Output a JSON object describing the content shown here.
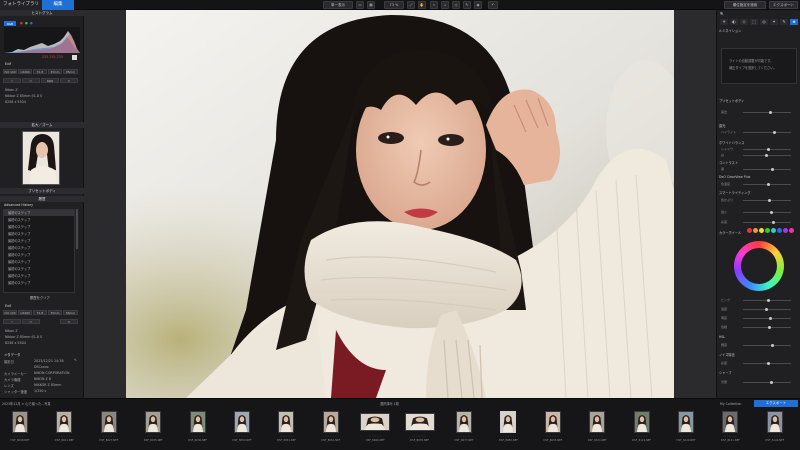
{
  "topbar": {
    "tab_photolibrary": "フォトライブラリ",
    "tab_edit": "編集",
    "view_select": "単一表示",
    "zoom": "73 %",
    "right_button_1": "順位指定を適用",
    "right_button_2": "エクスポート"
  },
  "left_panel": {
    "histogram_title": "ヒストグラム",
    "histogram_mode": "RGB",
    "histogram_values": "255  255  255",
    "exif_title": "Exif",
    "exif_row1": [
      "ISO 100",
      "1/4000",
      "f/1.8",
      "35mm",
      "85mm"
    ],
    "exif_row2": [
      "",
      "",
      "RAW",
      ""
    ],
    "exif_camera": "Nikon Z",
    "exif_lens": "Nikkor Z 85mm f/1.8 S",
    "exif_size": "8256 x 5504",
    "navigator_title": "拡大／ズーム",
    "presets_title": "プリセットボディ",
    "history_title": "履歴",
    "history_subtitle": "Advanced History",
    "history_items": [
      "最初のステップ",
      "最初のステップ",
      "最初のステップ",
      "最初のステップ",
      "最初のステップ",
      "最初のステップ",
      "最初のステップ",
      "最初のステップ",
      "最初のステップ",
      "最初のステップ",
      "最初のステップ"
    ],
    "history_clear": "履歴をクリア",
    "exif2_title": "Exif",
    "exif2_row1": [
      "ISO 100",
      "1/4000",
      "f/1.8",
      "35mm",
      "85mm"
    ],
    "exif2_camera": "Nikon Z",
    "exif2_lens": "Nikkor Z 85mm f/1.8 S",
    "exif2_size": "8256 x 5504",
    "meta_title": "メタデータ",
    "meta_rows": [
      {
        "label": "撮影日",
        "value": "2023/12/21 14:38"
      },
      {
        "label": "",
        "value": "DSCxxxx"
      },
      {
        "label": "カメラメーカー",
        "value": "NIKON CORPORATION"
      },
      {
        "label": "カメラ機種",
        "value": "NIKON Z 8"
      },
      {
        "label": "レンズ",
        "value": "NIKKOR Z 85mm"
      },
      {
        "label": "シャッター速度",
        "value": "1/250 s"
      }
    ]
  },
  "right_panel": {
    "top_title": "ルミネイション",
    "top_note_1": "ライトの自動調整が可能です。",
    "top_note_2": "補正タイプを選択してください。",
    "section_1": "プリセットボディ",
    "section_2": "露光",
    "section_3": "ホワイトバランス",
    "section_4": "コントラスト",
    "section_5": "DxO ClearView Plus",
    "section_6": "スマートライティング",
    "section_7": "カラーホイール",
    "section_8": "HSL",
    "section_9": "ノイズ除去",
    "section_10": "シャープ",
    "slider_labels": [
      "露出",
      "ハイライト",
      "シャドウ",
      "白",
      "黒",
      "色温度",
      "色かぶり",
      "強さ",
      "彩度",
      "ピンク",
      "適度",
      "明度",
      "色相",
      "輝度",
      "彩度",
      "光量"
    ]
  },
  "filmstrip": {
    "path_label": "2023年12月 > 山で撮った...写真",
    "count_label": "選択済み 1枚",
    "collection_btn": "My Collection",
    "export_btn": "エクスポート",
    "files": [
      "DSF_8018.NEF",
      "DSF_8021.NEF",
      "DSF_8027.NEF",
      "DSF_8035.NEF",
      "DSF_8036.NEF",
      "DSF_8050.NEF",
      "DSF_8051.NEF",
      "DSF_8061.NEF",
      "DSF_8066.NEF",
      "DSF_8070.NEF",
      "DSF_8077.NEF",
      "DSF_8083.NEF",
      "DSF_8095.NEF",
      "DSF_8101.NEF",
      "DSF_8119.NEF",
      "DSF_8120.NEF",
      "DSF_8131.NEF",
      "DSF_8142.NEF"
    ]
  },
  "colors": {
    "accent": "#1f6fd6",
    "panel": "#202023",
    "topbar": "#141416"
  }
}
